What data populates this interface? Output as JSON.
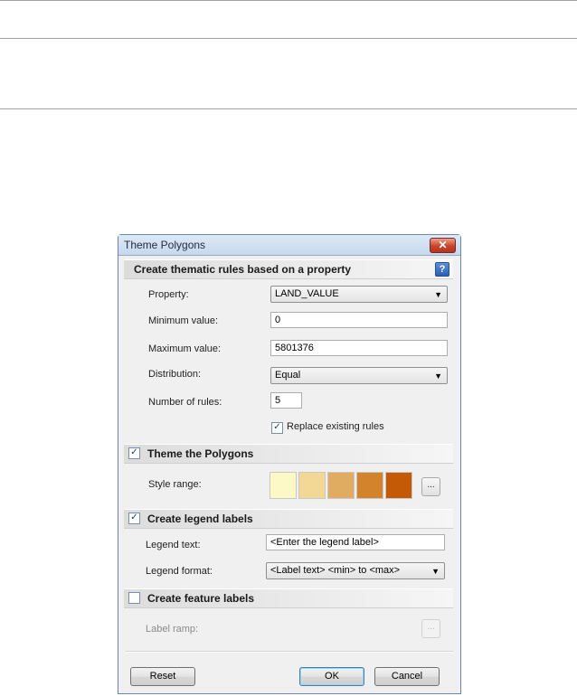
{
  "dialog": {
    "title": "Theme Polygons",
    "close_icon": "close-icon"
  },
  "section_rules": {
    "title": "Create thematic rules based on a property",
    "help_icon": "help-icon",
    "property_label": "Property:",
    "property_value": "LAND_VALUE",
    "min_label": "Minimum value:",
    "min_value": "0",
    "max_label": "Maximum value:",
    "max_value": "5801376",
    "distribution_label": "Distribution:",
    "distribution_value": "Equal",
    "rules_label": "Number of rules:",
    "rules_value": "5",
    "replace_label": "Replace existing rules",
    "replace_checked": true
  },
  "section_theme": {
    "title": "Theme the Polygons",
    "checked": true,
    "style_range_label": "Style range:",
    "colors": [
      "#fdf9c6",
      "#f2d795",
      "#e1ab62",
      "#d4832d",
      "#c55a06"
    ],
    "more_button": "..."
  },
  "section_legend": {
    "title": "Create legend labels",
    "checked": true,
    "text_label": "Legend text:",
    "text_value": "<Enter the legend label>",
    "format_label": "Legend format:",
    "format_value": "<Label text> <min> to <max>"
  },
  "section_feature": {
    "title": "Create feature labels",
    "checked": false,
    "ramp_label": "Label ramp:",
    "more_button": "..."
  },
  "buttons": {
    "reset": "Reset",
    "ok": "OK",
    "cancel": "Cancel"
  }
}
